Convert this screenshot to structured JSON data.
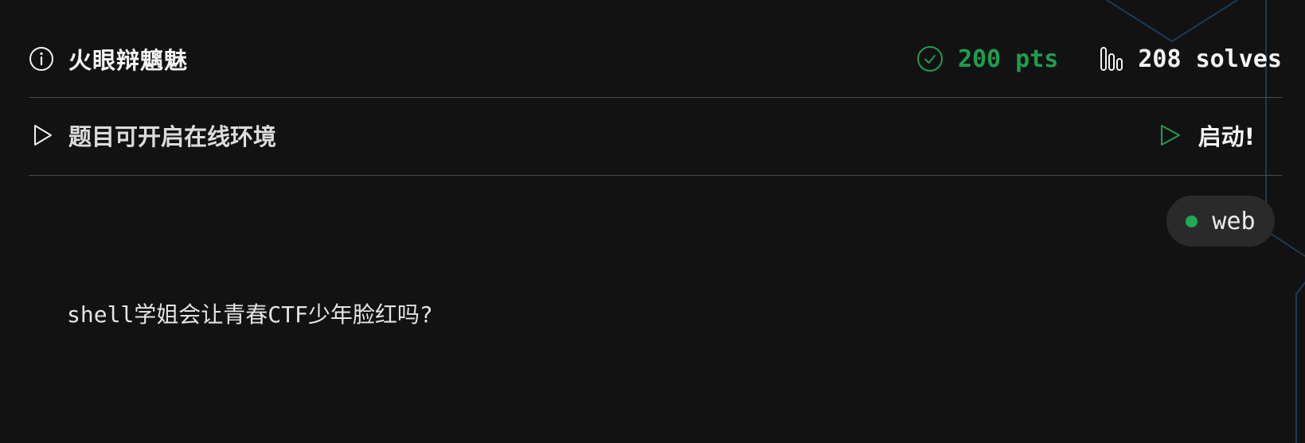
{
  "challenge": {
    "title": "火眼辩魑魅",
    "points": "200 pts",
    "solves": "208 solves"
  },
  "environment": {
    "notice": "题目可开启在线环境",
    "launch_label": "启动!"
  },
  "tags": [
    {
      "label": "web",
      "color": "#1fa855"
    }
  ],
  "description": "shell学姐会让青春CTF少年脸红吗?",
  "colors": {
    "background": "#121212",
    "accent_green": "#1f9d4f",
    "divider": "#4a4a4a",
    "tag_background": "#2a2a2a",
    "decoration_line": "#1c3a57"
  },
  "icons": {
    "info": "info-circle-icon",
    "points": "check-circle-icon",
    "solves": "bar-chart-icon",
    "environment": "play-outline-icon",
    "launch": "play-outline-icon"
  }
}
